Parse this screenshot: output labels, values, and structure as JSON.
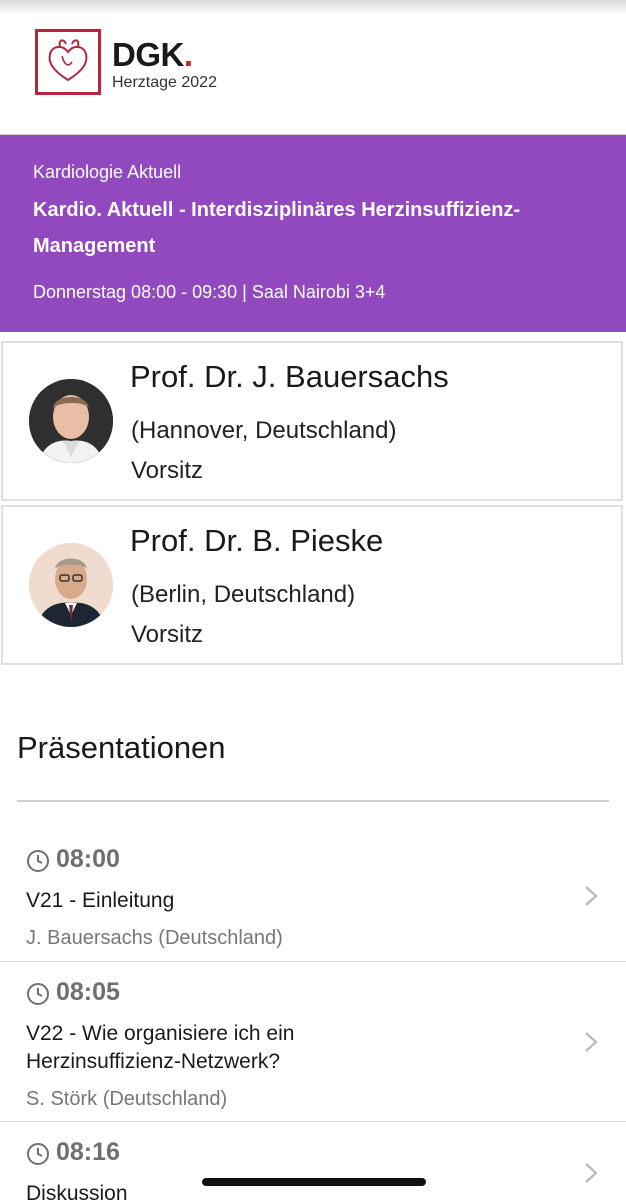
{
  "header": {
    "logo_word": "DGK",
    "logo_dot": ".",
    "logo_subtitle": "Herztage 2022"
  },
  "session": {
    "category": "Kardiologie Aktuell",
    "title": "Kardio. Aktuell - Interdisziplinäres Herzinsuffizienz-Management",
    "when": "Donnerstag 08:00 - 09:30 | Saal Nairobi 3+4",
    "accent_color": "#9249bf"
  },
  "chairs": [
    {
      "name": "Prof. Dr. J. Bauersachs",
      "location": "(Hannover, Deutschland)",
      "role": "Vorsitz"
    },
    {
      "name": "Prof. Dr. B. Pieske",
      "location": "(Berlin, Deutschland)",
      "role": "Vorsitz"
    }
  ],
  "presentations": {
    "heading": "Präsentationen",
    "items": [
      {
        "time": "08:00",
        "title": "V21 - Einleitung",
        "speaker": "J. Bauersachs (Deutschland)"
      },
      {
        "time": "08:05",
        "title": "V22 - Wie organisiere ich ein Herzinsuffizienz-Netzwerk?",
        "speaker": "S. Störk (Deutschland)"
      },
      {
        "time": "08:16",
        "title": "Diskussion",
        "speaker": ""
      }
    ]
  },
  "icons": {
    "clock": "clock-icon",
    "chevron": "chevron-right-icon",
    "logo": "heart-logo-icon"
  }
}
